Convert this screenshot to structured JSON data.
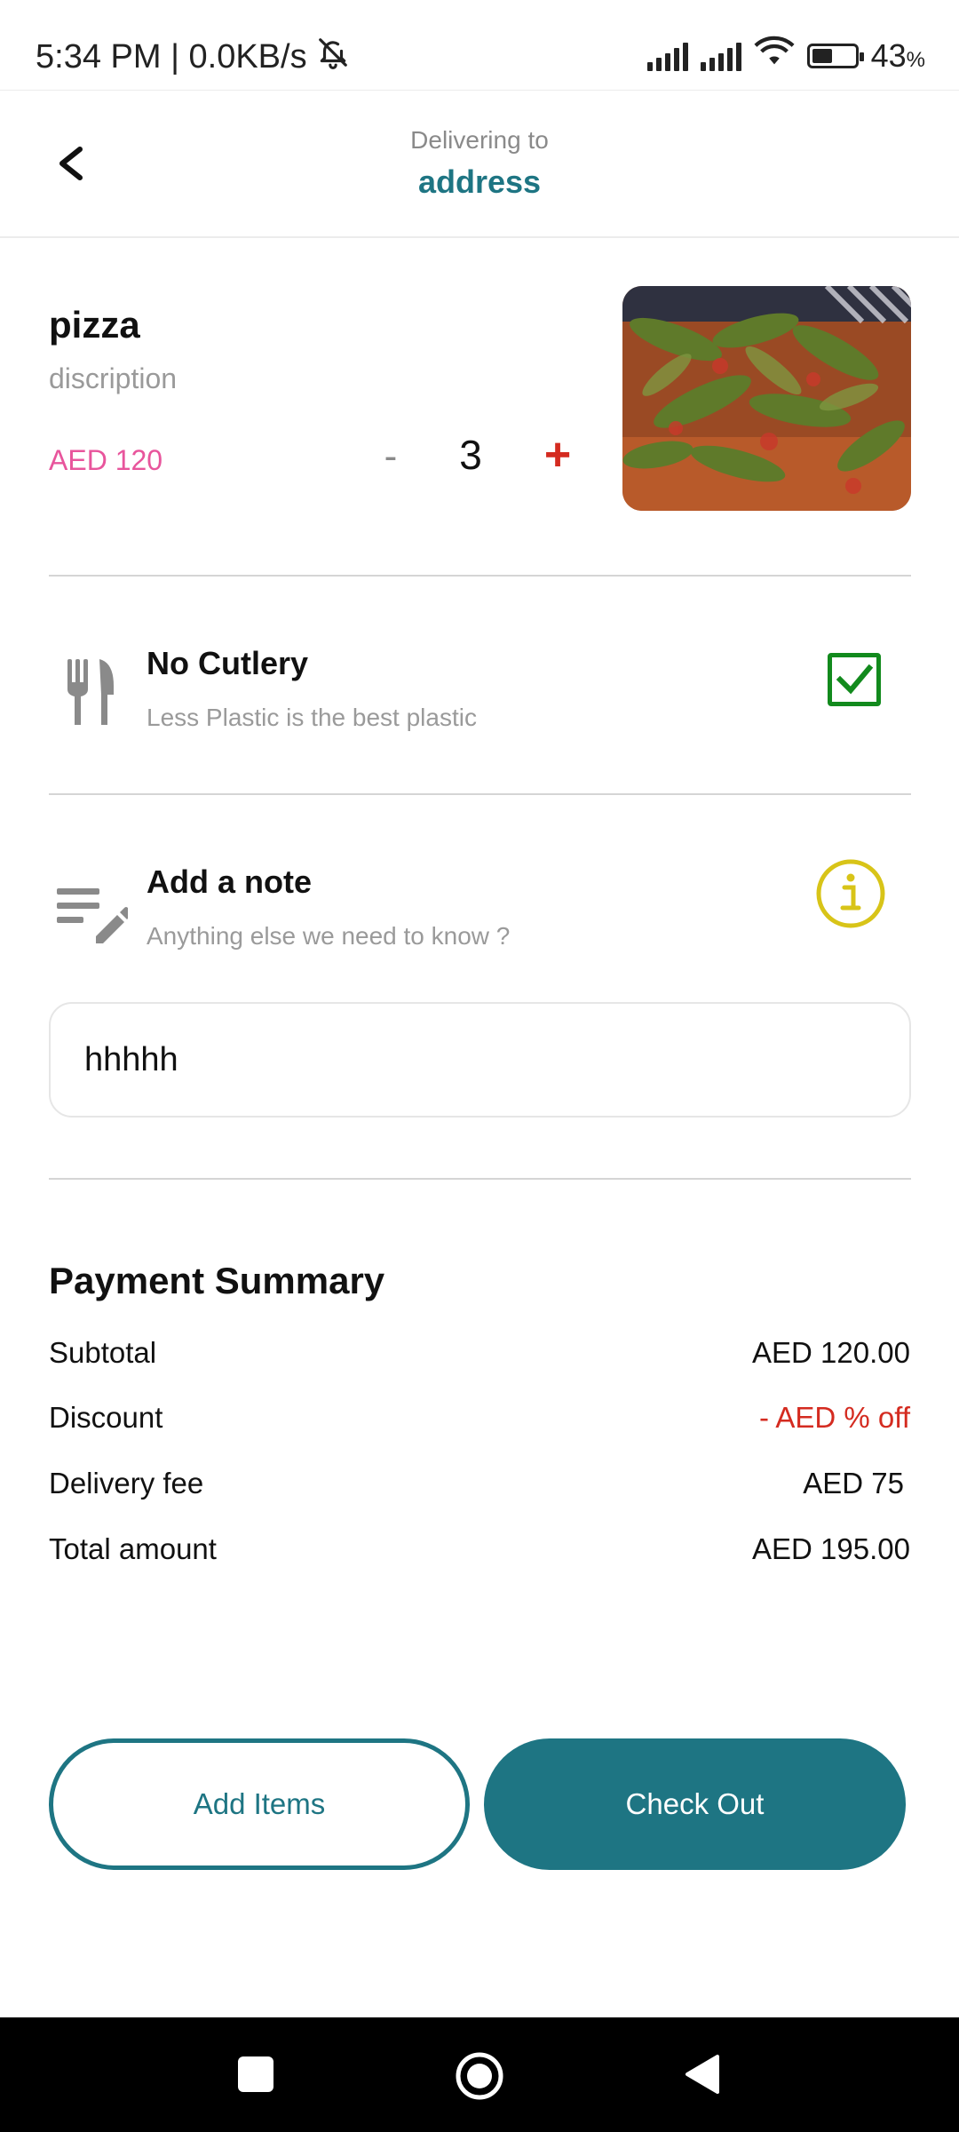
{
  "status_bar": {
    "time_speed": "5:34 PM | 0.0KB/s",
    "battery_percent": "43",
    "battery_unit": "%",
    "battery_level": 0.43
  },
  "header": {
    "subtitle": "Delivering to",
    "title": "address"
  },
  "item": {
    "name": "pizza",
    "description": "discription",
    "price": "AED 120",
    "quantity": "3",
    "minus_label": "-",
    "plus_label": "+"
  },
  "cutlery": {
    "title": "No Cutlery",
    "subtitle": "Less Plastic is the best plastic",
    "checked": true
  },
  "note": {
    "title": "Add a note",
    "subtitle": "Anything else we need to know ?",
    "value": "hhhhh"
  },
  "summary": {
    "title": "Payment Summary",
    "rows": [
      {
        "label": "Subtotal",
        "value": "AED 120.00"
      },
      {
        "label": "Discount",
        "value": "- AED % off"
      },
      {
        "label": "Delivery fee",
        "value": "AED 75"
      },
      {
        "label": "Total amount",
        "value": "AED 195.00"
      }
    ]
  },
  "buttons": {
    "add_items": "Add Items",
    "check_out": "Check Out"
  },
  "colors": {
    "brand_teal": "#1e7583",
    "price_pink": "#e8559c",
    "discount_red": "#d42b20",
    "checkbox_green": "#128a1d",
    "info_yellow": "#d8c418"
  }
}
